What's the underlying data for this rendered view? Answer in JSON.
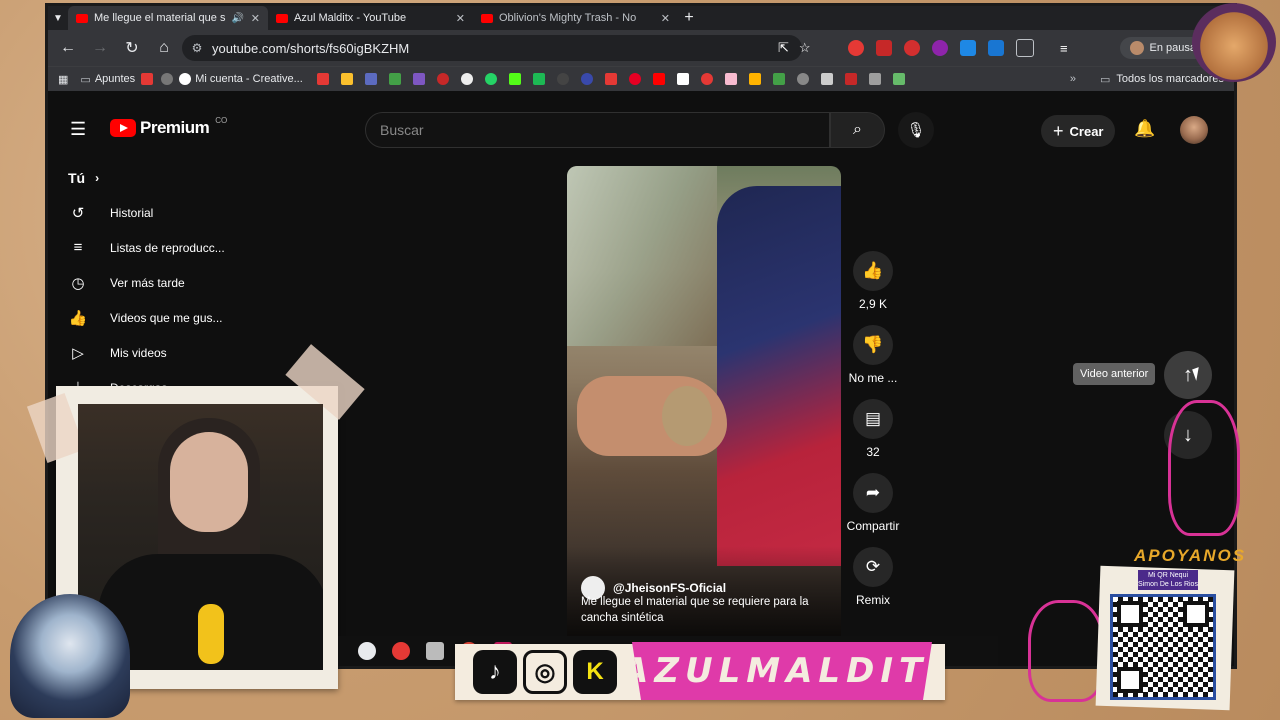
{
  "tabs": [
    {
      "title": "Me llegue el material que s",
      "active": true
    },
    {
      "title": "Azul Malditx - YouTube",
      "active": false
    },
    {
      "title": "Oblivion's Mighty Trash - No",
      "active": false
    }
  ],
  "address": {
    "url": "youtube.com/shorts/fs60igBKZHM"
  },
  "profile_status": "En pausa",
  "bookmarks": {
    "items": [
      "Apuntes",
      "Mi cuenta - Creative..."
    ],
    "all_label": "Todos los marcadores"
  },
  "youtube": {
    "logo_text": "Premium",
    "logo_sup": "CO",
    "search_placeholder": "Buscar",
    "create_label": "Crear",
    "sidebar": {
      "you_label": "Tú",
      "items": [
        {
          "label": "Historial",
          "icon": "history-icon"
        },
        {
          "label": "Listas de reproducc...",
          "icon": "playlists-icon"
        },
        {
          "label": "Ver más tarde",
          "icon": "watch-later-icon"
        },
        {
          "label": "Videos que me gus...",
          "icon": "liked-icon"
        },
        {
          "label": "Mis videos",
          "icon": "my-videos-icon"
        },
        {
          "label": "Descargas",
          "icon": "downloads-icon"
        }
      ]
    },
    "short": {
      "channel": "@JheisonFS-Oficial",
      "caption": "Me llegue el material que se requiere para la cancha sintética"
    },
    "actions": [
      {
        "label": "2,9 K",
        "icon": "thumbs-up-icon"
      },
      {
        "label": "No me ...",
        "icon": "thumbs-down-icon"
      },
      {
        "label": "32",
        "icon": "comment-icon"
      },
      {
        "label": "Compartir",
        "icon": "share-icon"
      },
      {
        "label": "Remix",
        "icon": "remix-icon"
      }
    ],
    "tooltip": "Video anterior"
  },
  "overlay": {
    "brand": "/AZULMALDITX",
    "apoyanos": "APOYANOS",
    "qr_label_line1": "Mi QR Nequi",
    "qr_label_line2": "Simon De Los Rios"
  },
  "colors": {
    "yt_red": "#ff0000",
    "bg_dark": "#0f0f0f",
    "accent_pink": "#df3aa9"
  }
}
